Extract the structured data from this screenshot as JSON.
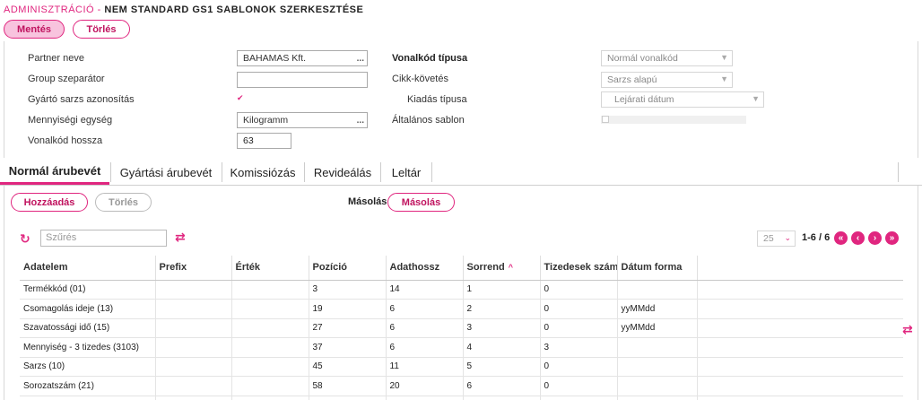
{
  "header": {
    "section": "ADMINISZTRÁCIÓ -",
    "title": "NEM STANDARD GS1 SABLONOK SZERKESZTÉSE",
    "save_label": "Mentés",
    "delete_label": "Törlés"
  },
  "form": {
    "partner_label": "Partner neve",
    "partner_value": "BAHAMAS Kft.",
    "group_sep_label": "Group szeparátor",
    "group_sep_value": "",
    "batch_id_label": "Gyártó sarzs azonosítás",
    "unit_label": "Mennyiségi egység",
    "unit_value": "Kilogramm",
    "barcode_len_label": "Vonalkód hossza",
    "barcode_len_value": "63",
    "barcode_type_label": "Vonalkód típusa",
    "barcode_type_value": "Normál vonalkód",
    "tracking_label": "Cikk-követés",
    "tracking_value": "Sarzs alapú",
    "issue_type_label": "Kiadás típusa",
    "issue_type_value": "Lejárati dátum",
    "general_template_label": "Általános sablon",
    "dots": "..."
  },
  "tabs": [
    {
      "label": "Normál árubevét"
    },
    {
      "label": "Gyártási árubevét"
    },
    {
      "label": "Komissiózás"
    },
    {
      "label": "Revideálás"
    },
    {
      "label": "Leltár"
    }
  ],
  "toolbar": {
    "add_label": "Hozzáadás",
    "delete_label": "Törlés",
    "copy_caption": "Másolás",
    "copy_button": "Másolás",
    "filter_placeholder": "Szűrés",
    "page_size": "25",
    "page_info": "1-6 / 6"
  },
  "table": {
    "columns": [
      "Adatelem",
      "Prefix",
      "Érték",
      "Pozíció",
      "Adathossz",
      "Sorrend",
      "Tizedesek szám",
      "Dátum forma",
      ""
    ],
    "rows": [
      [
        "Termékkód (01)",
        "",
        "",
        "3",
        "14",
        "1",
        "0",
        "",
        ""
      ],
      [
        "Csomagolás ideje (13)",
        "",
        "",
        "19",
        "6",
        "2",
        "0",
        "yyMMdd",
        ""
      ],
      [
        "Szavatossági idő (15)",
        "",
        "",
        "27",
        "6",
        "3",
        "0",
        "yyMMdd",
        ""
      ],
      [
        "Mennyiség - 3 tizedes (3103)",
        "",
        "",
        "37",
        "6",
        "4",
        "3",
        "",
        ""
      ],
      [
        "Sarzs (10)",
        "",
        "",
        "45",
        "11",
        "5",
        "0",
        "",
        ""
      ],
      [
        "Sorozatszám (21)",
        "",
        "",
        "58",
        "20",
        "6",
        "0",
        "",
        ""
      ],
      [
        "",
        "",
        "",
        "",
        "",
        "",
        "",
        "",
        ""
      ]
    ]
  },
  "colors": {
    "accent": "#e0267f",
    "accent_light": "#f8c3de"
  }
}
